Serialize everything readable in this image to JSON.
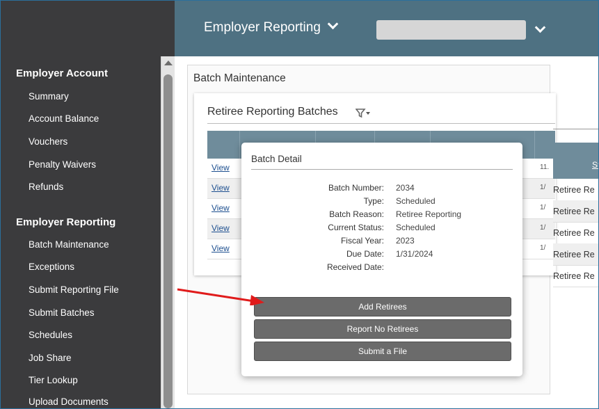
{
  "sidebar": {
    "sections": [
      {
        "heading": "Employer Account",
        "items": [
          "Summary",
          "Account Balance",
          "Vouchers",
          "Penalty Waivers",
          "Refunds"
        ]
      },
      {
        "heading": "Employer Reporting",
        "items": [
          "Batch Maintenance",
          "Exceptions",
          "Submit Reporting File",
          "Submit Batches",
          "Schedules",
          "Job Share",
          "Tier Lookup",
          "Upload Documents"
        ]
      }
    ]
  },
  "header": {
    "menu_title": "Employer Reporting",
    "select_value": ""
  },
  "main": {
    "panel_title": "Batch Maintenance",
    "card_title": "Retiree Reporting Batches",
    "rows": [
      {
        "link": "View",
        "edge": "11."
      },
      {
        "link": "View",
        "edge": "1/"
      },
      {
        "link": "View",
        "edge": "1/"
      },
      {
        "link": "View",
        "edge": "1/"
      },
      {
        "link": "View",
        "edge": "1/"
      }
    ],
    "right_table": {
      "header_fragment": "St",
      "rows": [
        "Retiree Re",
        "Retiree Re",
        "Retiree Re",
        "Retiree Re",
        "Retiree Re"
      ]
    }
  },
  "popup": {
    "title": "Batch Detail",
    "fields": [
      {
        "label": "Batch Number:",
        "value": "2034"
      },
      {
        "label": "Type:",
        "value": "Scheduled"
      },
      {
        "label": "Batch Reason:",
        "value": "Retiree Reporting"
      },
      {
        "label": "Current Status:",
        "value": "Scheduled"
      },
      {
        "label": "Fiscal Year:",
        "value": "2023"
      },
      {
        "label": "Due Date:",
        "value": "1/31/2024"
      },
      {
        "label": "Received Date:",
        "value": ""
      }
    ],
    "buttons": {
      "add": "Add Retirees",
      "no_report": "Report No Retirees",
      "submit": "Submit a File"
    }
  },
  "colors": {
    "sidebar_bg": "#3b3b3d",
    "header_bg": "#4e7182",
    "table_header_bg": "#6f8c9b",
    "button_bg": "#6b6b6b",
    "annotation_arrow": "#e01b1b"
  }
}
